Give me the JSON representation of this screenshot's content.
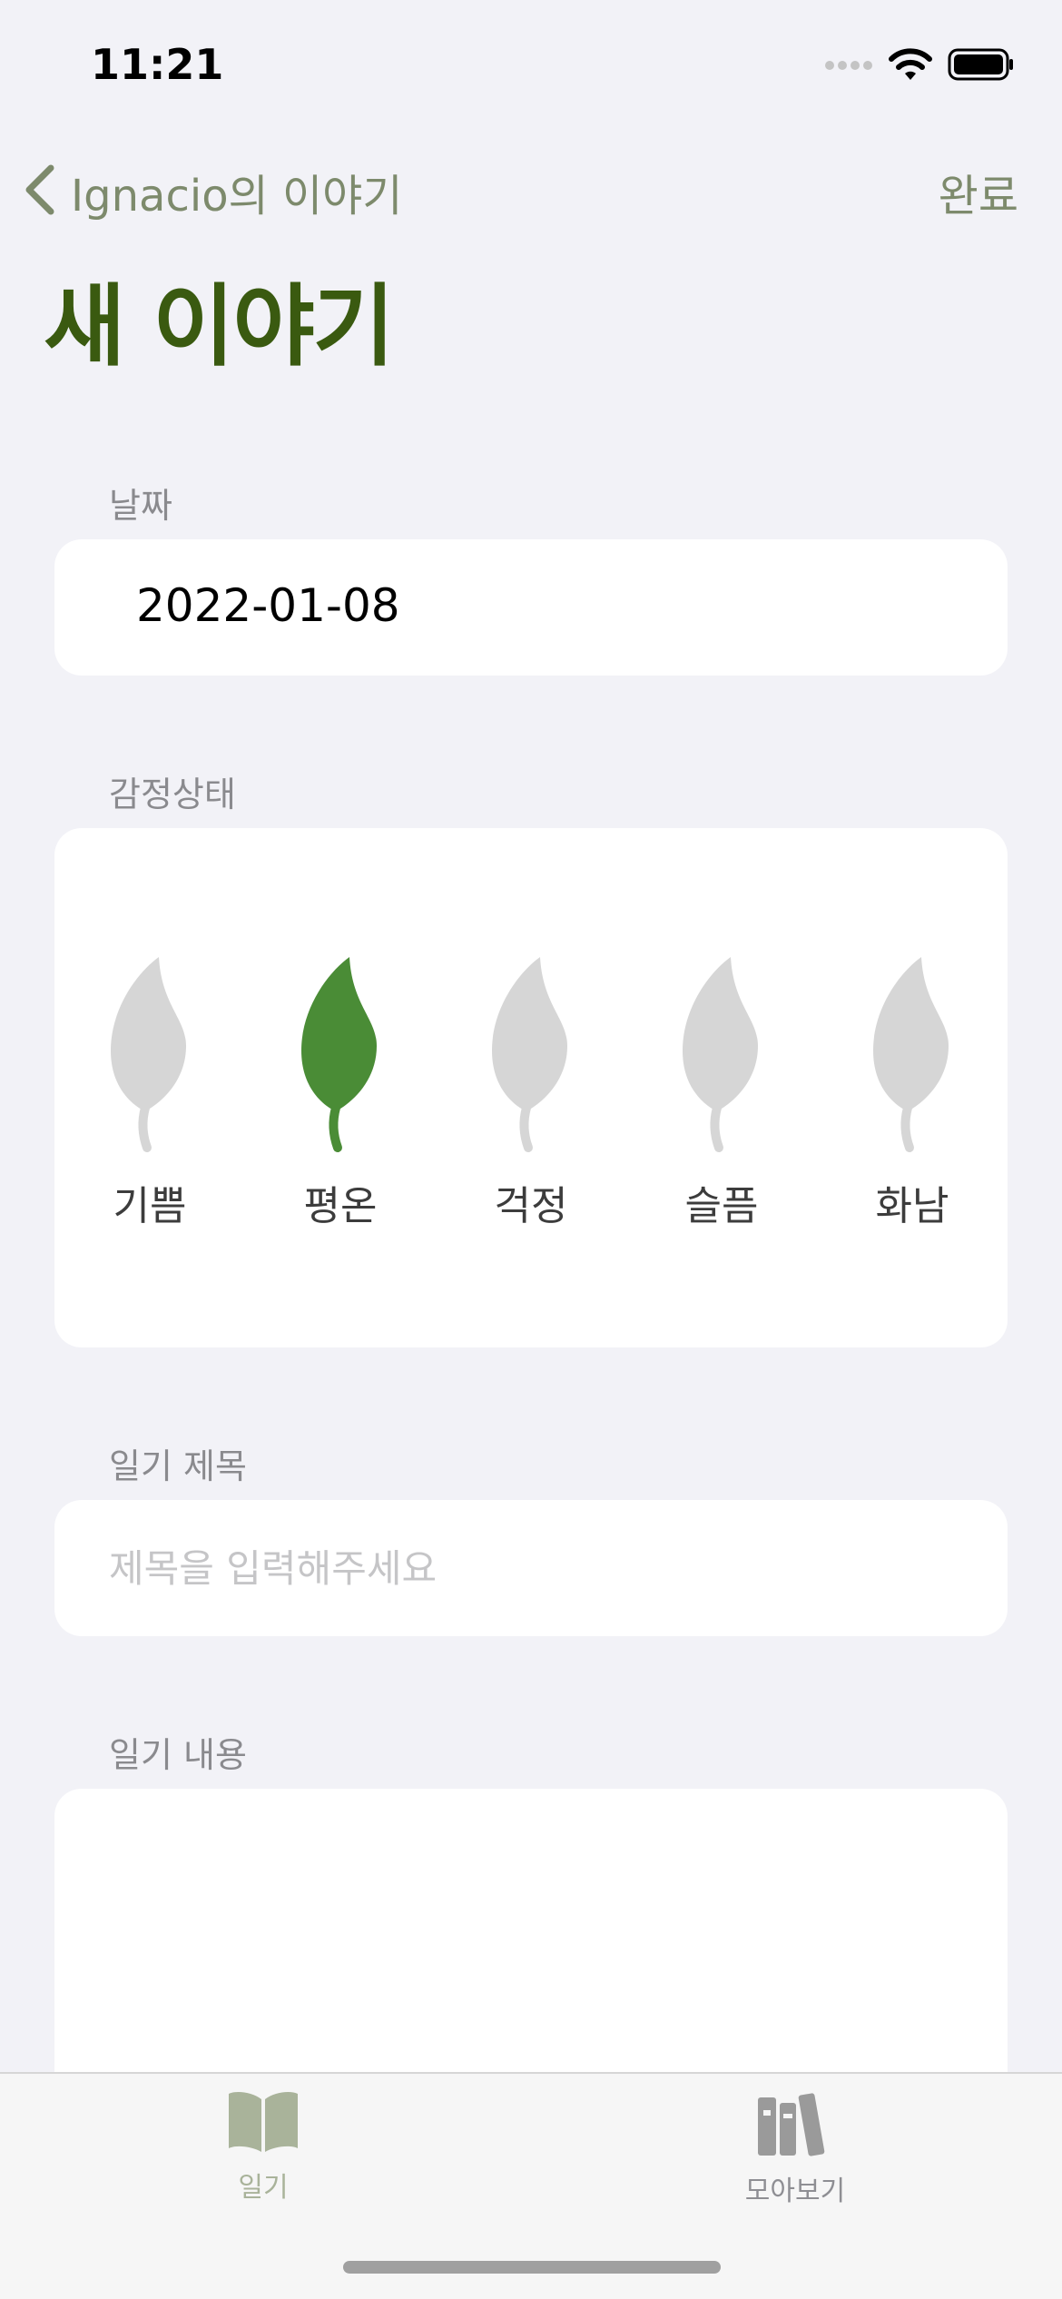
{
  "status_bar": {
    "time": "11:21"
  },
  "nav": {
    "back_label": "Ignacio의 이야기",
    "done_label": "완료"
  },
  "page": {
    "title": "새 이야기"
  },
  "date_section": {
    "label": "날짜",
    "value": "2022-01-08"
  },
  "mood_section": {
    "label": "감정상태",
    "selected_index": 1,
    "selected_color": "#4a8c36",
    "unselected_color": "#d6d6d6",
    "items": [
      {
        "label": "기쁨"
      },
      {
        "label": "평온"
      },
      {
        "label": "걱정"
      },
      {
        "label": "슬픔"
      },
      {
        "label": "화남"
      }
    ]
  },
  "title_section": {
    "label": "일기 제목",
    "placeholder": "제목을 입력해주세요",
    "value": ""
  },
  "content_section": {
    "label": "일기 내용",
    "value": ""
  },
  "tab_bar": {
    "tabs": [
      {
        "label": "일기",
        "icon": "book-icon",
        "active": true
      },
      {
        "label": "모아보기",
        "icon": "books-icon",
        "active": false
      }
    ]
  },
  "colors": {
    "accent": "#7d8a6c",
    "title": "#3a5a10",
    "background": "#f2f2f7"
  }
}
